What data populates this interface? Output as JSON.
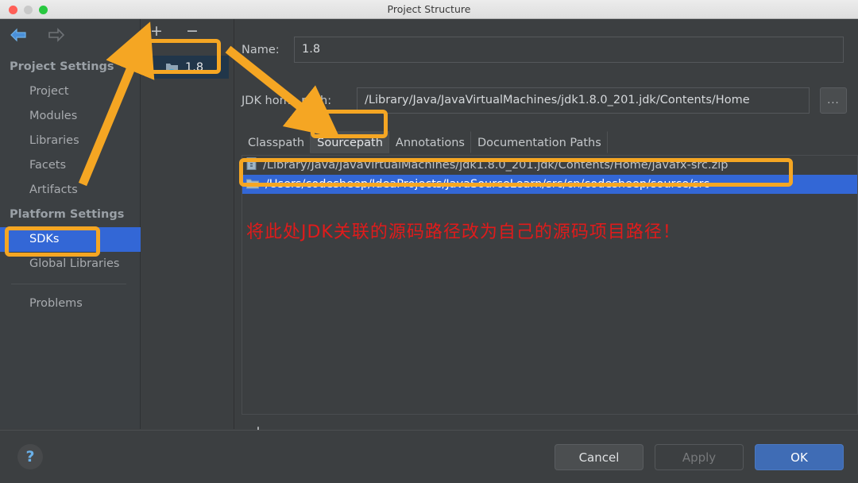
{
  "window": {
    "title": "Project Structure",
    "traffic_lights": [
      "close-red",
      "minimize-amber",
      "zoom-green"
    ]
  },
  "sidebar": {
    "back_icon": "back-arrow-icon",
    "forward_icon": "forward-arrow-icon",
    "groups": [
      {
        "label": "Project Settings",
        "items": [
          {
            "label": "Project",
            "selected": false
          },
          {
            "label": "Modules",
            "selected": false
          },
          {
            "label": "Libraries",
            "selected": false
          },
          {
            "label": "Facets",
            "selected": false
          },
          {
            "label": "Artifacts",
            "selected": false
          }
        ]
      },
      {
        "label": "Platform Settings",
        "items": [
          {
            "label": "SDKs",
            "selected": true
          },
          {
            "label": "Global Libraries",
            "selected": false
          }
        ]
      }
    ],
    "problems_label": "Problems"
  },
  "sdk_panel": {
    "add_label": "+",
    "remove_label": "−",
    "icon": "jdk-folder-icon",
    "items": [
      {
        "label": "1.8",
        "selected": true
      }
    ]
  },
  "detail": {
    "name_label": "Name:",
    "name_value": "1.8",
    "jdk_home_label": "JDK home path:",
    "jdk_home_value": "/Library/Java/JavaVirtualMachines/jdk1.8.0_201.jdk/Contents/Home",
    "browse_label": "...",
    "tabs": [
      {
        "label": "Classpath",
        "active": false
      },
      {
        "label": "Sourcepath",
        "active": true
      },
      {
        "label": "Annotations",
        "active": false
      },
      {
        "label": "Documentation Paths",
        "active": false
      }
    ],
    "paths": [
      {
        "text": "/Library/Java/JavaVirtualMachines/jdk1.8.0_201.jdk/Contents/Home/javafx-src.zip",
        "icon": "zip-archive-icon",
        "selected": false
      },
      {
        "text": "/Users/codesheep/IdeaProjects/JavaSourceLearn/src/cn/codesheep/source/src",
        "icon": "folder-icon",
        "selected": true
      }
    ],
    "list_add_label": "+",
    "list_remove_label": "−"
  },
  "annotation": {
    "note_text": "将此处JDK关联的源码路径改为自己的源码项目路径！",
    "note_color": "#e01b1b",
    "highlight_color": "#f5a623"
  },
  "footer": {
    "help_label": "?",
    "cancel_label": "Cancel",
    "apply_label": "Apply",
    "ok_label": "OK"
  }
}
